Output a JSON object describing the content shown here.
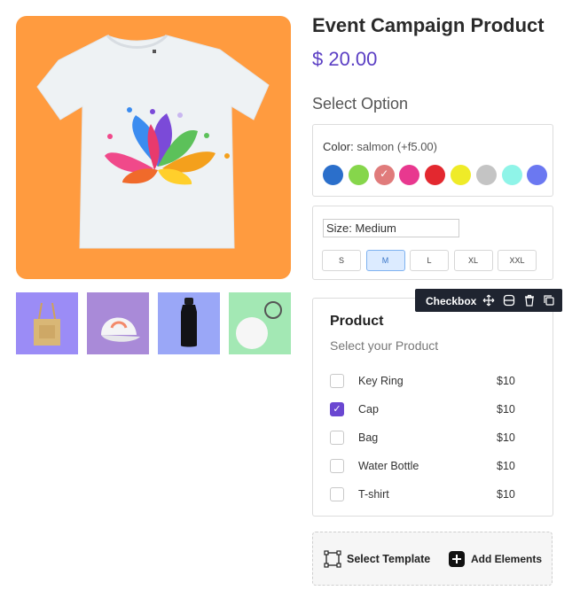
{
  "product": {
    "title": "Event Campaign Product",
    "price": "$ 20.00",
    "select_option_heading": "Select Option"
  },
  "hero_image": {
    "subject": "white t-shirt with colorful lotus logo",
    "background": "#ff9b3f"
  },
  "thumbnails": [
    {
      "name": "tote-bag",
      "background": "#9b8cf6"
    },
    {
      "name": "cap",
      "background": "#a98ad8"
    },
    {
      "name": "water-bottle",
      "background": "#9aa7f7"
    },
    {
      "name": "key-ring",
      "background": "#a3e8b4"
    }
  ],
  "color_option": {
    "label": "Color:",
    "value": "salmon (+f5.00)",
    "swatches": [
      {
        "name": "blue",
        "color": "#2b6fcb",
        "selected": false
      },
      {
        "name": "green",
        "color": "#86d64b",
        "selected": false
      },
      {
        "name": "salmon",
        "color": "#e07b7b",
        "selected": true
      },
      {
        "name": "pink",
        "color": "#e8388f",
        "selected": false
      },
      {
        "name": "red",
        "color": "#e3282f",
        "selected": false
      },
      {
        "name": "yellow",
        "color": "#efeb28",
        "selected": false
      },
      {
        "name": "gray",
        "color": "#c4c4c4",
        "selected": false
      },
      {
        "name": "aqua",
        "color": "#8ff4e8",
        "selected": false
      },
      {
        "name": "periwinkle",
        "color": "#6b78f1",
        "selected": false
      }
    ]
  },
  "size_option": {
    "label": "Size:",
    "value": "Medium",
    "sizes": [
      {
        "label": "S",
        "active": false
      },
      {
        "label": "M",
        "active": true
      },
      {
        "label": "L",
        "active": false
      },
      {
        "label": "XL",
        "active": false
      },
      {
        "label": "XXL",
        "active": false
      }
    ]
  },
  "element_toolbar": {
    "label": "Checkbox"
  },
  "product_checklist": {
    "title": "Product",
    "subtitle": "Select your Product",
    "items": [
      {
        "name": "Key Ring",
        "price": "$10",
        "checked": false
      },
      {
        "name": "Cap",
        "price": "$10",
        "checked": true
      },
      {
        "name": "Bag",
        "price": "$10",
        "checked": false
      },
      {
        "name": "Water Bottle",
        "price": "$10",
        "checked": false
      },
      {
        "name": "T-shirt",
        "price": "$10",
        "checked": false
      }
    ]
  },
  "footer": {
    "select_template_label": "Select Template",
    "add_elements_label": "Add Elements"
  },
  "colors": {
    "accent": "#5b3fc4",
    "checkbox_checked": "#6a47d1",
    "toolbar_bg": "#1f2430"
  }
}
